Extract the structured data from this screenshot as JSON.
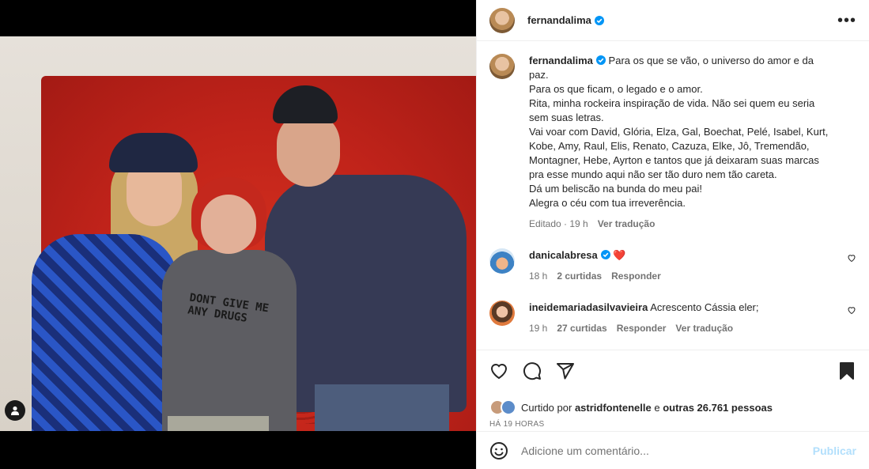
{
  "post": {
    "author": "fernandalima",
    "verified": true,
    "caption_lines": [
      "Para os que se vão, o universo do amor e da",
      "paz.",
      "Para os que ficam, o legado e o amor.",
      "Rita, minha rockeira inspiração de vida. Não sei quem eu seria",
      "sem suas letras.",
      "Vai voar com David, Glória, Elza, Gal, Boechat, Pelé, Isabel, Kurt,",
      "Kobe, Amy, Raul, Elis, Renato, Cazuza, Elke, Jô, Tremendão,",
      "Montagner, Hebe, Ayrton e tantos que já deixaram suas marcas",
      "pra esse mundo aqui não ser tão duro nem tão careta.",
      "Dá um beliscão na bunda do meu pai!",
      "Alegra o céu com tua irreverência."
    ],
    "caption_meta": {
      "edited": "Editado · 19 h",
      "translate": "Ver tradução"
    },
    "shirt_text": "DONT GIVE ME ANY DRUGS"
  },
  "comments": [
    {
      "username": "danicalabresa",
      "verified": true,
      "text": "❤️",
      "time": "18 h",
      "likes": "2 curtidas",
      "reply": "Responder",
      "translate": ""
    },
    {
      "username": "ineidemariadasilvavieira",
      "verified": false,
      "text": "Acrescento Cássia eler;",
      "time": "19 h",
      "likes": "27 curtidas",
      "reply": "Responder",
      "translate": "Ver tradução"
    }
  ],
  "likes": {
    "prefix": "Curtido por",
    "user": "astridfontenelle",
    "middle": "e",
    "others": "outras 26.761 pessoas"
  },
  "timestamp": "HÁ 19 HORAS",
  "add_comment": {
    "placeholder": "Adicione um comentário...",
    "publish": "Publicar"
  },
  "colors": {
    "accent": "#0095f6",
    "verified": "#0095f6",
    "heart": "#ed4956",
    "publish_disabled": "#b2dffc"
  }
}
